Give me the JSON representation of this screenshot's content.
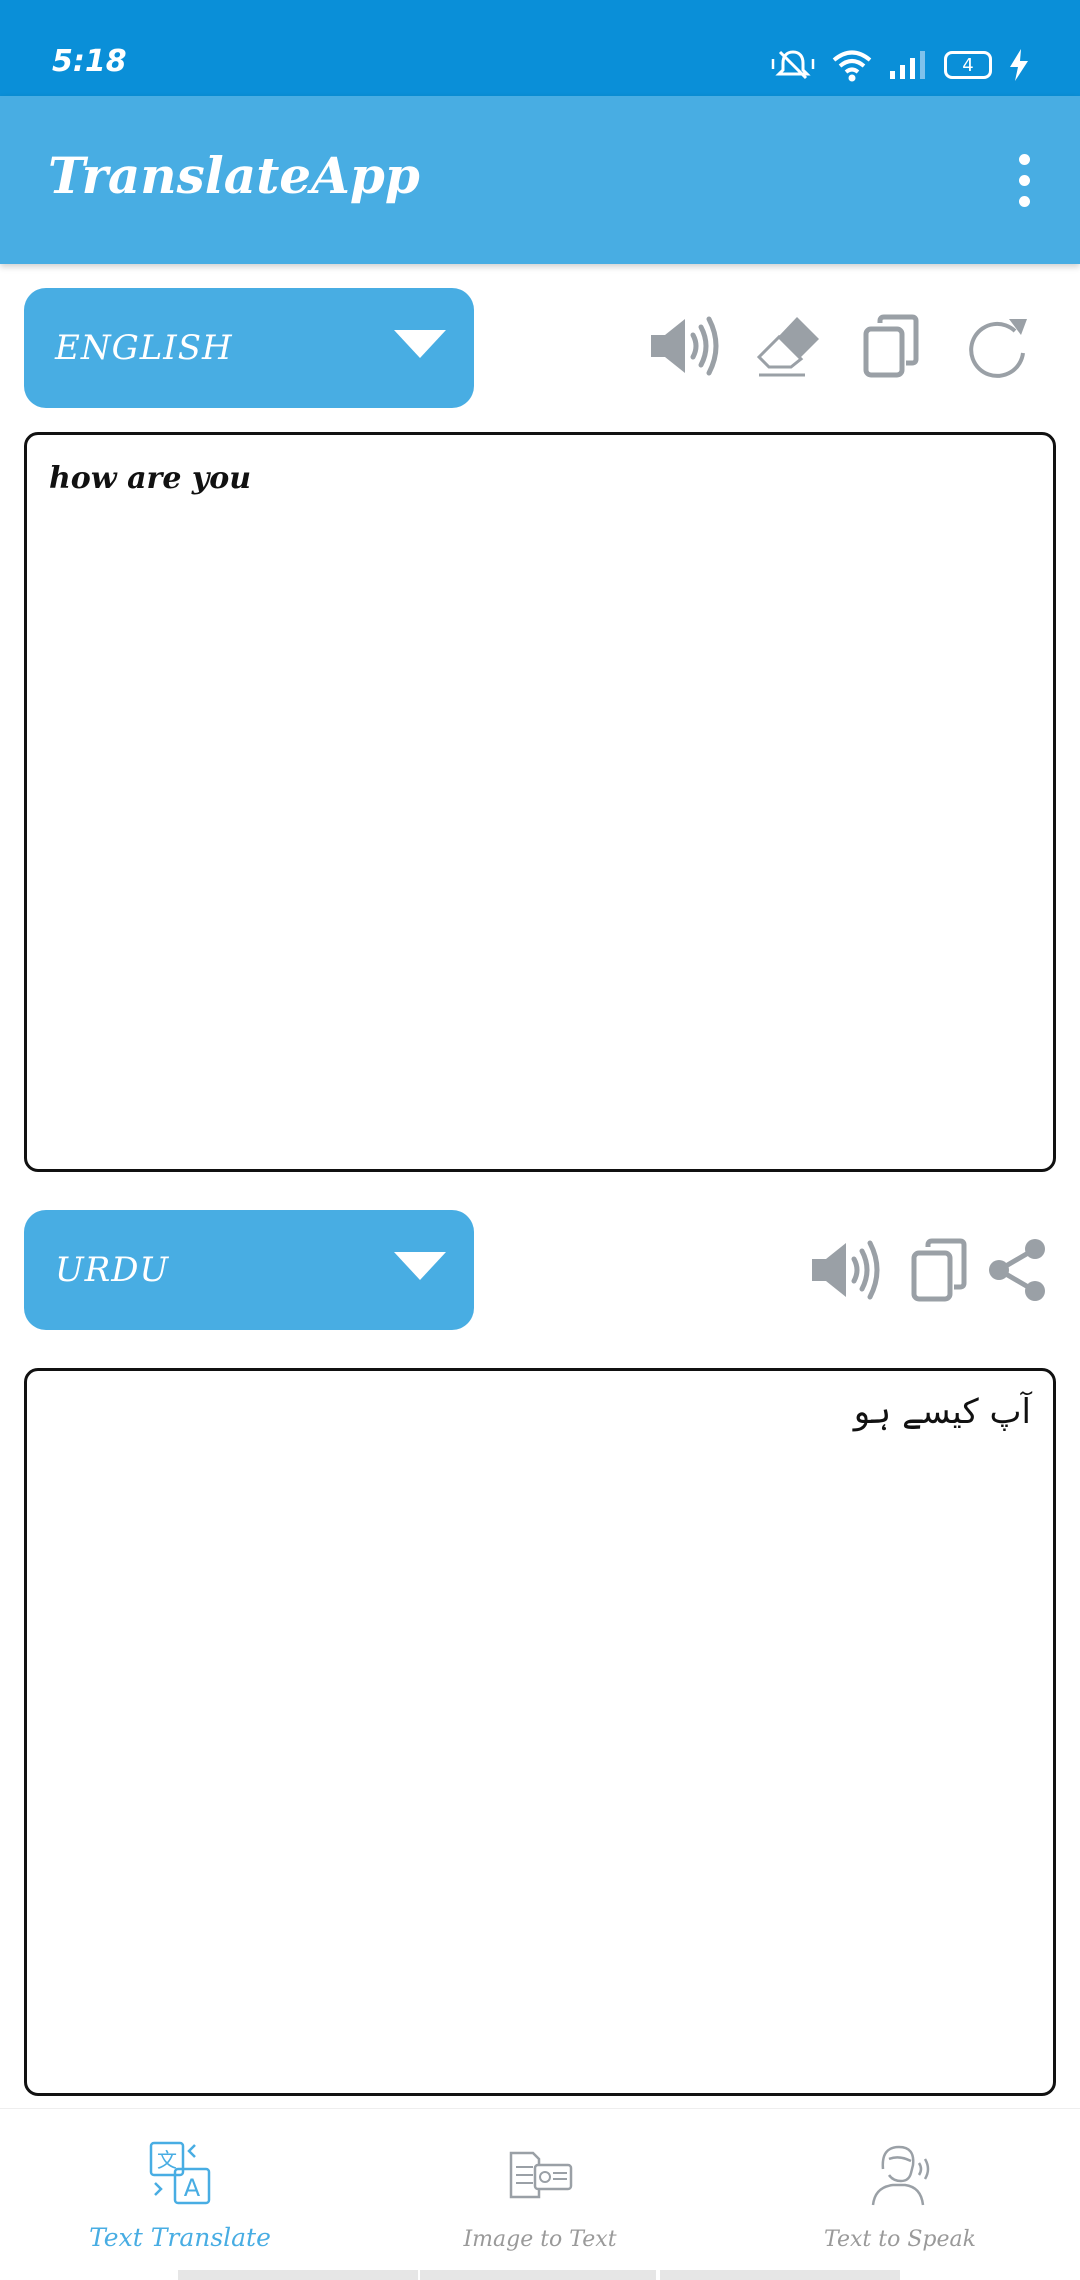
{
  "status_bar": {
    "time": "5:18",
    "battery": "4"
  },
  "app_bar": {
    "title": "TranslateApp"
  },
  "source": {
    "language": "ENGLISH",
    "text": "how are you",
    "tools": [
      "speaker-icon",
      "eraser-icon",
      "copy-icon",
      "refresh-icon"
    ]
  },
  "target": {
    "language": "URDU",
    "text": "آپ کیسے ہو",
    "tools": [
      "speaker-icon",
      "copy-icon",
      "share-icon"
    ]
  },
  "bottom_nav": {
    "items": [
      {
        "label": "Text Translate",
        "icon": "translate-icon",
        "active": true
      },
      {
        "label": "Image to Text",
        "icon": "image-to-text-icon",
        "active": false
      },
      {
        "label": "Text to Speak",
        "icon": "text-to-speak-icon",
        "active": false
      }
    ]
  },
  "colors": {
    "status_bar": "#0a8fd8",
    "app_bar": "#48ade3",
    "icon_gray": "#9aa0a6",
    "active_nav": "#48ade3"
  }
}
